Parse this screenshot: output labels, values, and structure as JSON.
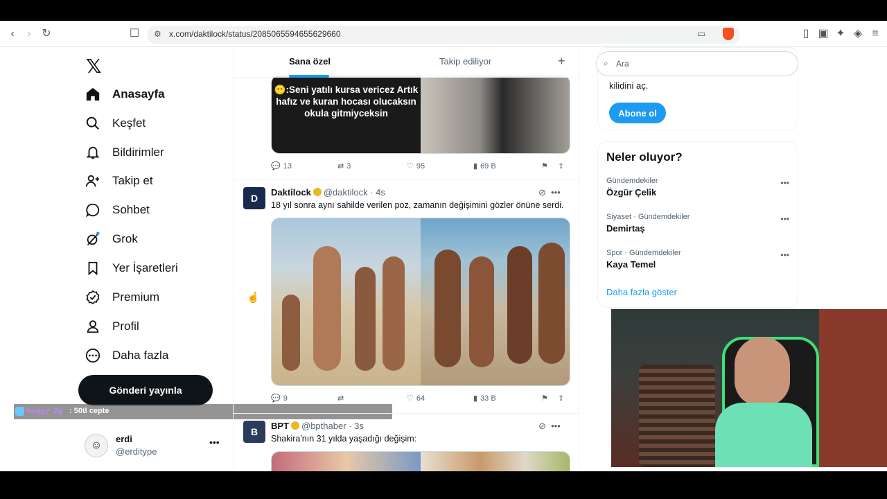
{
  "browser": {
    "url": "x.com/daktilock/status/2085065594655629660"
  },
  "nav": {
    "items": [
      {
        "label": "Anasayfa",
        "icon": "home-icon",
        "active": true
      },
      {
        "label": "Keşfet",
        "icon": "search-icon"
      },
      {
        "label": "Bildirimler",
        "icon": "bell-icon"
      },
      {
        "label": "Takip et",
        "icon": "follow-icon"
      },
      {
        "label": "Sohbet",
        "icon": "chat-icon"
      },
      {
        "label": "Grok",
        "icon": "grok-icon"
      },
      {
        "label": "Yer İşaretleri",
        "icon": "bookmark-icon"
      },
      {
        "label": "Premium",
        "icon": "premium-icon"
      },
      {
        "label": "Profil",
        "icon": "profile-icon"
      },
      {
        "label": "Daha fazla",
        "icon": "more-icon"
      }
    ],
    "post_button": "Gönderi yayınla"
  },
  "overlay": {
    "user": "buggy_2g",
    "message": ": 50tl cepte"
  },
  "account": {
    "name": "erdi",
    "handle": "@erditype"
  },
  "feed": {
    "tabs": [
      "Sana özel",
      "Takip ediliyor"
    ],
    "tweet0": {
      "media_caption": "😶:Seni yatılı kursa vericez Artık hafız ve kuran hocası olucaksın okula gitmiyceksin",
      "replies": "13",
      "retweets": "3",
      "likes": "95",
      "views": "69 B"
    },
    "tweet1": {
      "name": "Daktilock",
      "handle": "@daktilock",
      "time": "· 4s",
      "text": "18 yıl sonra aynı sahilde verilen poz, zamanın değişimini gözler önüne serdi.",
      "replies": "9",
      "retweets": "",
      "likes": "64",
      "views": "33 B"
    },
    "tweet2": {
      "name": "BPT",
      "handle": "@bpthaber",
      "time": "· 3s",
      "text": "Shakira'nın 31 yılda yaşadığı değişim:"
    }
  },
  "right": {
    "search_placeholder": "Ara",
    "premium_text": "kilidini aç.",
    "subscribe": "Abone ol",
    "trends_title": "Neler oluyor?",
    "trends": [
      {
        "category": "Gündemdekiler",
        "name": "Özgür Çelik"
      },
      {
        "category": "Siyaset · Gündemdekiler",
        "name": "Demirtaş"
      },
      {
        "category": "Spor · Gündemdekiler",
        "name": "Kaya Temel"
      }
    ],
    "show_more": "Daha fazla göster"
  }
}
